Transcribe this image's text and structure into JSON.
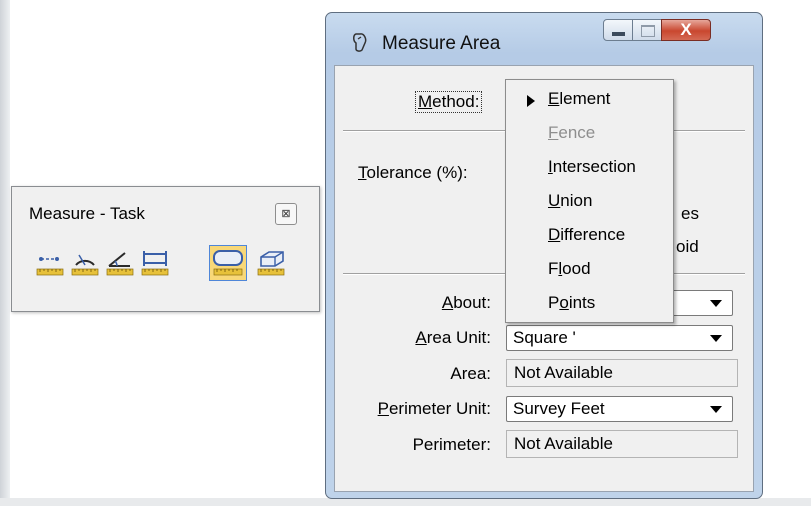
{
  "task_toolbar": {
    "title": "Measure - Task",
    "close_icon": "close-icon",
    "tools": [
      {
        "name": "measure-distance-icon",
        "active": false
      },
      {
        "name": "measure-radius-icon",
        "active": false
      },
      {
        "name": "measure-angle-icon",
        "active": false
      },
      {
        "name": "measure-length-icon",
        "active": false
      },
      {
        "name": "measure-area-icon",
        "active": true
      },
      {
        "name": "measure-volume-icon",
        "active": false
      }
    ]
  },
  "dialog": {
    "title": "Measure Area",
    "controls": {
      "minimize": "minimize-icon",
      "maximize": "maximize-icon",
      "close": "X"
    },
    "method_label": {
      "underline": "M",
      "rest": "ethod:"
    },
    "tolerance_label": {
      "underline": "T",
      "rest": "olerance (%):"
    },
    "partial_text_1": "es",
    "partial_text_2": "oid",
    "about": {
      "underline": "A",
      "rest": "bout:",
      "value": ""
    },
    "area_unit": {
      "underline": "A",
      "rest": "rea Unit:",
      "value": "Square '"
    },
    "area": {
      "label": "Area:",
      "value": "Not Available"
    },
    "perimeter_unit": {
      "underline": "P",
      "rest": "erimeter Unit:",
      "value": "Survey Feet"
    },
    "perimeter": {
      "label": "Perimeter:",
      "value": "Not Available"
    }
  },
  "method_menu": {
    "items": [
      {
        "underline": "E",
        "rest": "lement",
        "selected": true,
        "enabled": true
      },
      {
        "underline": "F",
        "rest": "ence",
        "selected": false,
        "enabled": false
      },
      {
        "underline": "I",
        "rest": "ntersection",
        "selected": false,
        "enabled": true
      },
      {
        "underline": "U",
        "rest": "nion",
        "selected": false,
        "enabled": true
      },
      {
        "underline": "D",
        "rest": "ifference",
        "selected": false,
        "enabled": true
      },
      {
        "underline": "l",
        "prefix": "F",
        "rest": "ood",
        "selected": false,
        "enabled": true
      },
      {
        "underline": "o",
        "prefix": "P",
        "rest": "ints",
        "selected": false,
        "enabled": true
      }
    ]
  },
  "colors": {
    "accent_active": "#f8d878",
    "active_border": "#4f86d8",
    "titlebar": "#c9dbef",
    "close_button": "#c9472f"
  }
}
